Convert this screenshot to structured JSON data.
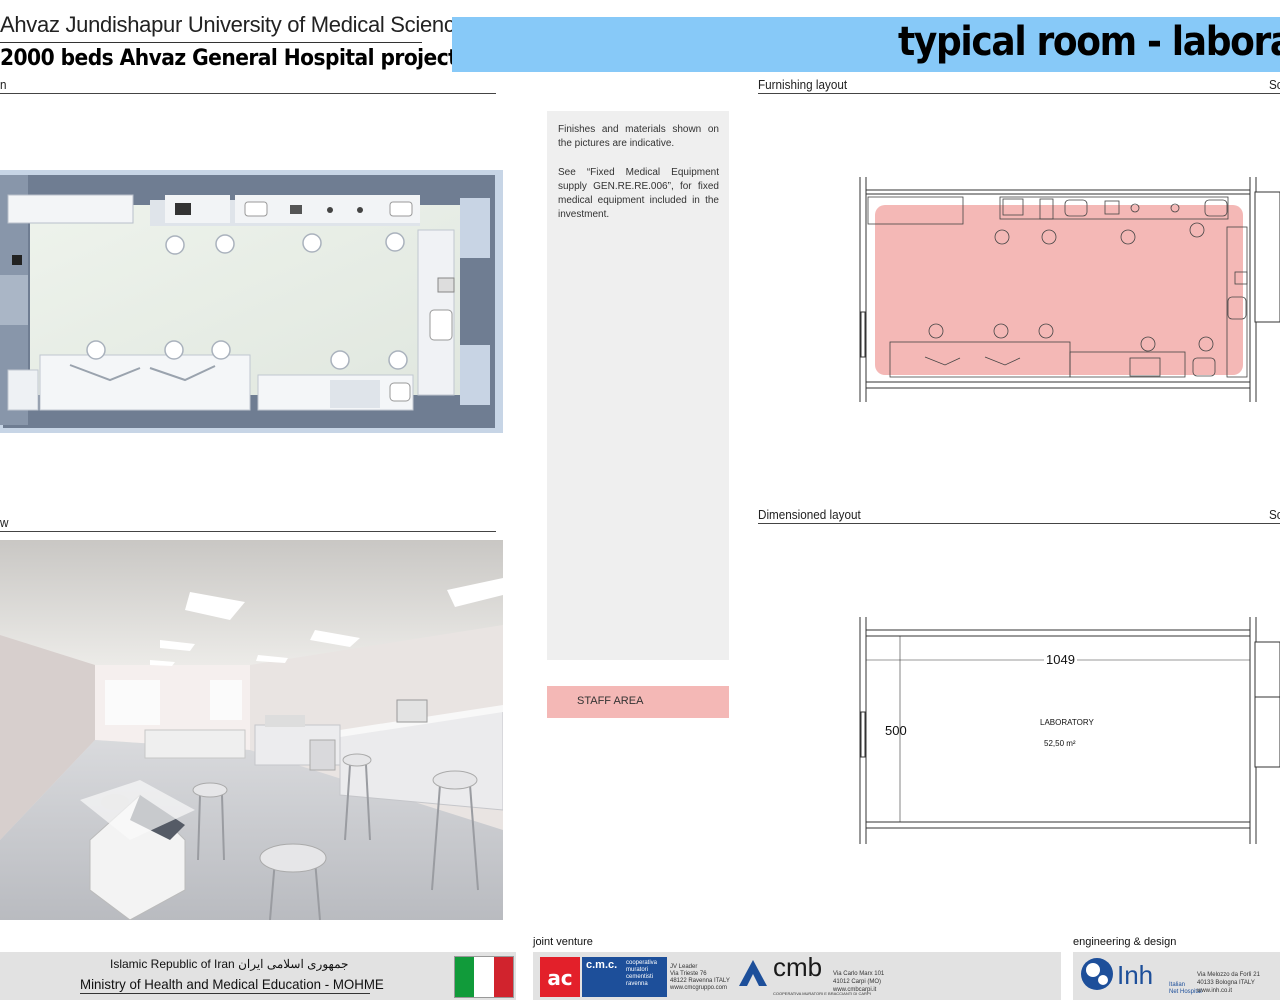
{
  "header": {
    "university": "Ahvaz Jundishapur University of Medical Sciences",
    "project": "2000 beds Ahvaz General Hospital project",
    "title": "typical room - laborato"
  },
  "sections": {
    "plan_label": "n",
    "view_label": "w",
    "furnishing_label": "Furnishing layout",
    "furnishing_scale": "Sc",
    "dimensioned_label": "Dimensioned layout",
    "dimensioned_scale": "Sc"
  },
  "notes": {
    "p1": "Finishes and materials  shown on the pictures are indicative.",
    "p2": "See “Fixed Medical Equipment supply GEN.RE.RE.006”, for fixed medical equipment included in the investment."
  },
  "legend": {
    "staff_area": "STAFF AREA"
  },
  "dimensioned": {
    "width": "1049",
    "depth": "500",
    "room_name": "LABORATORY",
    "room_area": "52,50  m²"
  },
  "footer": {
    "country": "Islamic Republic of Iran  جمهوری اسلامی ایران",
    "ministry": "Ministry of Health and Medical Education - MOHME",
    "joint_venture": "joint venture",
    "cmc_logo": "c.m.c.",
    "cmc_line1": "cooperativa",
    "cmc_line2": "muratori",
    "cmc_line3": "cementisti",
    "cmc_line4": "ravenna",
    "cmc_addr1": "JV Leader",
    "cmc_addr2": "Via Trieste 76",
    "cmc_addr3": "48122 Ravenna ITALY",
    "cmc_addr4": "www.cmcgruppo.com",
    "cmb_logo": "cmb",
    "cmb_sub": "COOPERATIVA MURATORI E BRACCIANTI DI CARPI",
    "cmb_addr1": "Via Carlo Marx 101",
    "cmb_addr2": "41012 Carpi (MO)",
    "cmb_addr3": "www.cmbcarpi.it",
    "engineering": "engineering & design",
    "inh_logo": "Inh",
    "inh_sub1": "Italian",
    "inh_sub2": "Net Hospital",
    "inh_addr1": "Via Melozzo da Forlì 21",
    "inh_addr2": "40133 Bologna ITALY",
    "inh_addr3": "www.inh.co.it"
  },
  "colors": {
    "banner": "#87c9f8",
    "staff_area": "#f4b8b6",
    "note_box": "#efefef",
    "footer": "#e2e2e2",
    "flag_green": "#119b3a",
    "flag_red": "#d1232d",
    "cmc_red": "#e3202a",
    "cmc_blue": "#1d4f9a"
  }
}
